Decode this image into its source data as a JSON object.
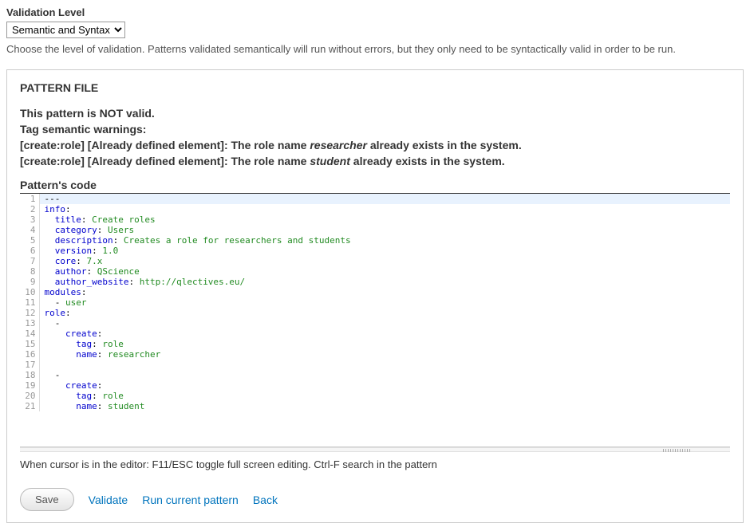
{
  "validation_field": {
    "label": "Validation Level",
    "selected": "Semantic and Syntax",
    "help": "Choose the level of validation. Patterns validated semantically will run without errors, but they only need to be syntactically valid in order to be run."
  },
  "panel": {
    "title": "PATTERN FILE",
    "status": "This pattern is NOT valid.",
    "warnings_heading": "Tag semantic warnings:",
    "warnings": [
      {
        "prefix": "[create:role] [Already defined element]: The role name ",
        "em": "researcher",
        "suffix": " already exists in the system."
      },
      {
        "prefix": "[create:role] [Already defined element]: The role name ",
        "em": "student",
        "suffix": " already exists in the system."
      }
    ],
    "code_heading": "Pattern's code"
  },
  "code_lines": [
    {
      "n": 1,
      "segments": [
        {
          "t": "---",
          "c": "tok-black"
        }
      ]
    },
    {
      "n": 2,
      "segments": [
        {
          "t": "info",
          "c": "tok-key"
        },
        {
          "t": ":",
          "c": "tok-black"
        }
      ]
    },
    {
      "n": 3,
      "segments": [
        {
          "t": "  ",
          "c": ""
        },
        {
          "t": "title",
          "c": "tok-key"
        },
        {
          "t": ": ",
          "c": "tok-black"
        },
        {
          "t": "Create roles",
          "c": "tok-val"
        }
      ]
    },
    {
      "n": 4,
      "segments": [
        {
          "t": "  ",
          "c": ""
        },
        {
          "t": "category",
          "c": "tok-key"
        },
        {
          "t": ": ",
          "c": "tok-black"
        },
        {
          "t": "Users",
          "c": "tok-val"
        }
      ]
    },
    {
      "n": 5,
      "segments": [
        {
          "t": "  ",
          "c": ""
        },
        {
          "t": "description",
          "c": "tok-key"
        },
        {
          "t": ": ",
          "c": "tok-black"
        },
        {
          "t": "Creates a role for researchers and students",
          "c": "tok-val"
        }
      ]
    },
    {
      "n": 6,
      "segments": [
        {
          "t": "  ",
          "c": ""
        },
        {
          "t": "version",
          "c": "tok-key"
        },
        {
          "t": ": ",
          "c": "tok-black"
        },
        {
          "t": "1.0",
          "c": "tok-val"
        }
      ]
    },
    {
      "n": 7,
      "segments": [
        {
          "t": "  ",
          "c": ""
        },
        {
          "t": "core",
          "c": "tok-key"
        },
        {
          "t": ": ",
          "c": "tok-black"
        },
        {
          "t": "7.x",
          "c": "tok-val"
        }
      ]
    },
    {
      "n": 8,
      "segments": [
        {
          "t": "  ",
          "c": ""
        },
        {
          "t": "author",
          "c": "tok-key"
        },
        {
          "t": ": ",
          "c": "tok-black"
        },
        {
          "t": "QScience",
          "c": "tok-val"
        }
      ]
    },
    {
      "n": 9,
      "segments": [
        {
          "t": "  ",
          "c": ""
        },
        {
          "t": "author_website",
          "c": "tok-key"
        },
        {
          "t": ": ",
          "c": "tok-black"
        },
        {
          "t": "http://qlectives.eu/",
          "c": "tok-val"
        }
      ]
    },
    {
      "n": 10,
      "segments": [
        {
          "t": "modules",
          "c": "tok-key"
        },
        {
          "t": ":",
          "c": "tok-black"
        }
      ]
    },
    {
      "n": 11,
      "segments": [
        {
          "t": "  - ",
          "c": "tok-black"
        },
        {
          "t": "user",
          "c": "tok-val"
        }
      ]
    },
    {
      "n": 12,
      "segments": [
        {
          "t": "role",
          "c": "tok-key"
        },
        {
          "t": ":",
          "c": "tok-black"
        }
      ]
    },
    {
      "n": 13,
      "segments": [
        {
          "t": "  -",
          "c": "tok-black"
        }
      ]
    },
    {
      "n": 14,
      "segments": [
        {
          "t": "    ",
          "c": ""
        },
        {
          "t": "create",
          "c": "tok-key"
        },
        {
          "t": ":",
          "c": "tok-black"
        }
      ]
    },
    {
      "n": 15,
      "segments": [
        {
          "t": "      ",
          "c": ""
        },
        {
          "t": "tag",
          "c": "tok-key"
        },
        {
          "t": ": ",
          "c": "tok-black"
        },
        {
          "t": "role",
          "c": "tok-val"
        }
      ]
    },
    {
      "n": 16,
      "segments": [
        {
          "t": "      ",
          "c": ""
        },
        {
          "t": "name",
          "c": "tok-key"
        },
        {
          "t": ": ",
          "c": "tok-black"
        },
        {
          "t": "researcher",
          "c": "tok-val"
        }
      ]
    },
    {
      "n": 17,
      "segments": [
        {
          "t": "",
          "c": ""
        }
      ]
    },
    {
      "n": 18,
      "segments": [
        {
          "t": "  -",
          "c": "tok-black"
        }
      ]
    },
    {
      "n": 19,
      "segments": [
        {
          "t": "    ",
          "c": ""
        },
        {
          "t": "create",
          "c": "tok-key"
        },
        {
          "t": ":",
          "c": "tok-black"
        }
      ]
    },
    {
      "n": 20,
      "segments": [
        {
          "t": "      ",
          "c": ""
        },
        {
          "t": "tag",
          "c": "tok-key"
        },
        {
          "t": ": ",
          "c": "tok-black"
        },
        {
          "t": "role",
          "c": "tok-val"
        }
      ]
    },
    {
      "n": 21,
      "segments": [
        {
          "t": "      ",
          "c": ""
        },
        {
          "t": "name",
          "c": "tok-key"
        },
        {
          "t": ": ",
          "c": "tok-black"
        },
        {
          "t": "student",
          "c": "tok-val"
        }
      ]
    }
  ],
  "hint": "When cursor is in the editor: F11/ESC toggle full screen editing. Ctrl-F search in the pattern",
  "actions": {
    "save": "Save",
    "validate": "Validate",
    "run": "Run current pattern",
    "back": "Back"
  }
}
